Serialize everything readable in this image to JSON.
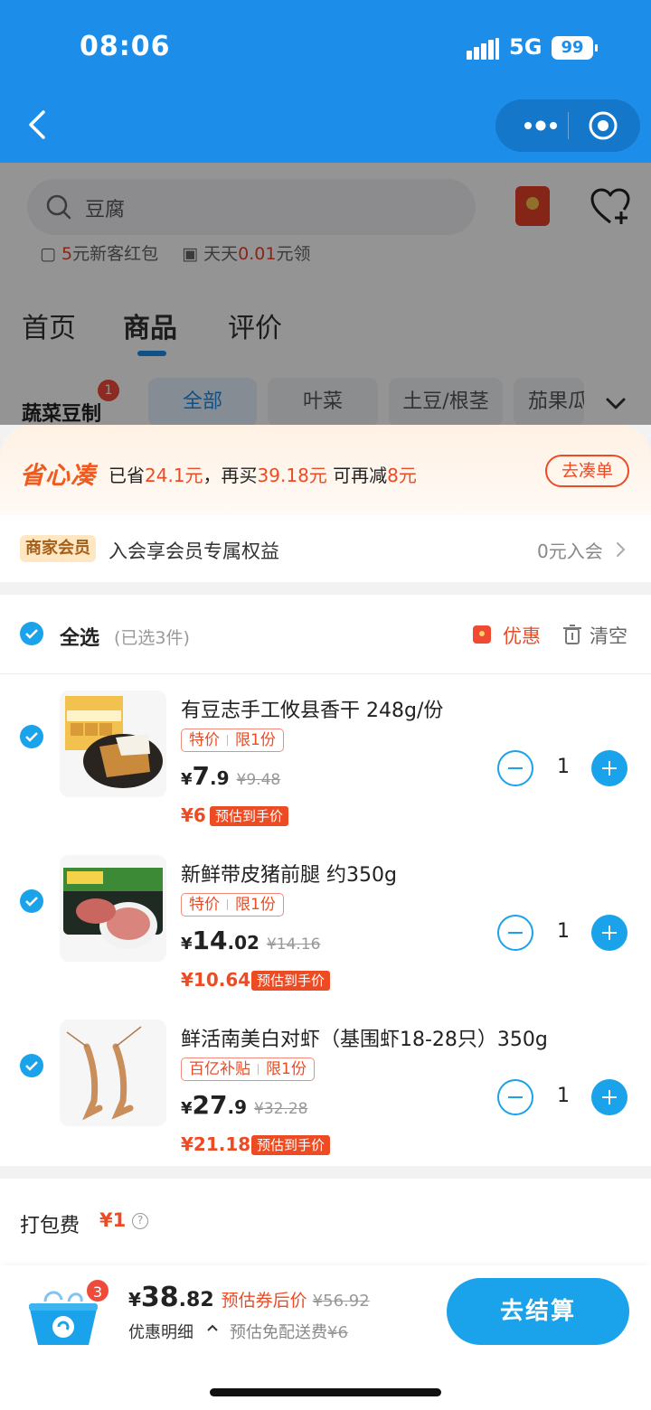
{
  "status_bar": {
    "time": "08:06",
    "network": "5G",
    "battery": "99"
  },
  "search": {
    "query": "豆腐"
  },
  "store_promos": {
    "new_customer_amount": "5",
    "new_customer_suffix": "元新客红包",
    "daily_prefix": "天天",
    "daily_amount": "0.01",
    "daily_suffix": "元领"
  },
  "tabs": [
    "首页",
    "商品",
    "评价"
  ],
  "category": {
    "label": "蔬菜豆制",
    "badge": "1",
    "chips": [
      "全部",
      "叶菜",
      "土豆/根茎",
      "茄果瓜"
    ]
  },
  "saving": {
    "logo": "省心凑",
    "saved_prefix": "已省",
    "saved_amount": "24.1元",
    "buy_prefix": "，再买",
    "buy_amount": "39.18元",
    "reduce_prefix": "可再减",
    "reduce_amount": "8元",
    "button": "去凑单"
  },
  "member": {
    "tag": "商家会员",
    "desc": "入会享会员专属权益",
    "join": "0元入会"
  },
  "cart_header": {
    "select_all": "全选",
    "selected_count": "(已选3件)",
    "discount": "优惠",
    "clear": "清空"
  },
  "items": [
    {
      "title": "有豆志手工攸县香干 248g/份",
      "tag1": "特价",
      "tag2": "限1份",
      "price_int": "7",
      "price_dec": ".9",
      "orig": "¥9.48",
      "est": "¥6",
      "est_tag": "预估到手价",
      "qty": "1"
    },
    {
      "title": "新鲜带皮猪前腿 约350g",
      "tag1": "特价",
      "tag2": "限1份",
      "price_int": "14",
      "price_dec": ".02",
      "orig": "¥14.16",
      "est": "¥10.64",
      "est_tag": "预估到手价",
      "qty": "1"
    },
    {
      "title": "鲜活南美白对虾（基围虾18-28只）350g",
      "tag1": "百亿补贴",
      "tag2": "限1份",
      "price_int": "27",
      "price_dec": ".9",
      "orig": "¥32.28",
      "est": "¥21.18",
      "est_tag": "预估到手价",
      "qty": "1"
    }
  ],
  "pack_fee": {
    "label": "打包费",
    "value": "¥1"
  },
  "bottom": {
    "basket_count": "3",
    "currency": "¥",
    "total_int": "38",
    "total_dec": ".82",
    "total_label": "预估券后价",
    "total_orig": "¥56.92",
    "detail": "优惠明细",
    "ship_label": "预估免配送费",
    "ship_orig": "¥6",
    "checkout": "去结算"
  },
  "colors": {
    "brand_blue": "#1c8eea",
    "accent_red": "#ec4b24",
    "check_blue": "#1aa2ea"
  }
}
